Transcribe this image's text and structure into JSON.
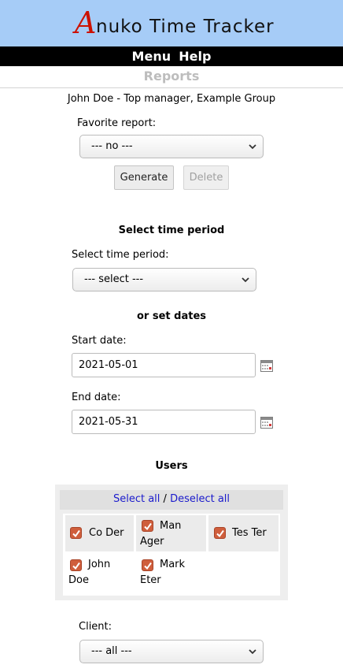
{
  "app": {
    "logo_letter": "A",
    "logo_rest": "nuko  Time  Tracker"
  },
  "menu": {
    "menu_label": "Menu",
    "help_label": "Help"
  },
  "page_title": "Reports",
  "user_info": "John Doe - Top manager, Example Group",
  "favorite": {
    "label": "Favorite report:",
    "selected": "--- no ---"
  },
  "buttons": {
    "generate": "Generate",
    "delete": "Delete"
  },
  "period": {
    "section_title": "Select time period",
    "label": "Select time period:",
    "selected": "--- select ---"
  },
  "dates": {
    "section_title": "or set dates",
    "start_label": "Start date:",
    "start_value": "2021-05-01",
    "end_label": "End date:",
    "end_value": "2021-05-31"
  },
  "users": {
    "section_title": "Users",
    "select_all": "Select all",
    "separator": "/",
    "deselect_all": "Deselect all",
    "list": [
      {
        "line1": "Co Der",
        "line2": "",
        "checked": true
      },
      {
        "line1": "Man",
        "line2": "Ager",
        "checked": true
      },
      {
        "line1": "Tes Ter",
        "line2": "",
        "checked": true
      },
      {
        "line1": "John",
        "line2": "Doe",
        "checked": true
      },
      {
        "line1": "Mark",
        "line2": "Eter",
        "checked": true
      }
    ]
  },
  "client": {
    "label": "Client:",
    "selected": "--- all ---"
  },
  "colors": {
    "header_bg": "#a6ccf7",
    "checkbox": "#cf5e3c",
    "link": "#1a1acc"
  },
  "icons": {
    "calendar": "calendar-icon",
    "chevron": "chevron-down-icon",
    "check": "checkmark-icon"
  }
}
